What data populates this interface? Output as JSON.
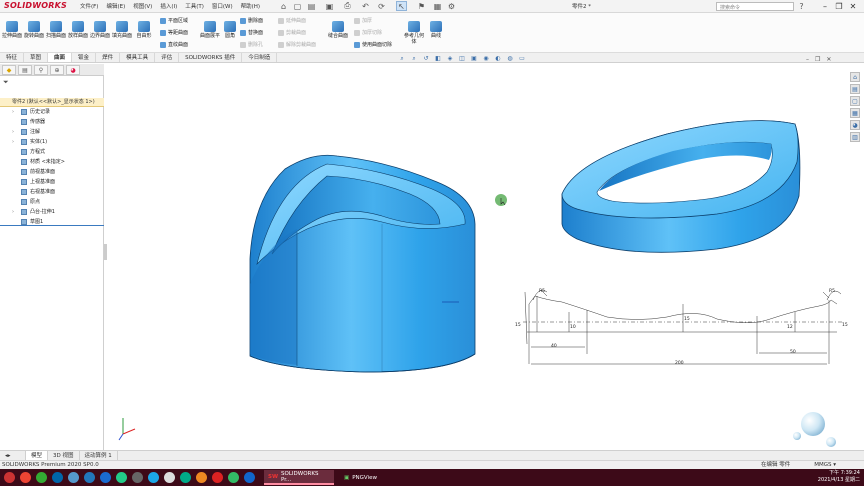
{
  "titlebar": {
    "logo": "SOLIDWORKS",
    "menus": [
      "文件(F)",
      "编辑(E)",
      "视图(V)",
      "插入(I)",
      "工具(T)",
      "窗口(W)",
      "帮助(H)"
    ],
    "document_title": "零件2 *",
    "search_placeholder": "搜索命令"
  },
  "ribbon": {
    "large_buttons": [
      "拉伸曲面",
      "旋转曲面",
      "扫描曲面",
      "放样曲面",
      "边界曲面",
      "填充曲面",
      "自由形"
    ],
    "small_col1": [
      "平面区域",
      "等距曲面",
      "直纹曲面"
    ],
    "mid_buttons": [
      "曲面展平",
      "圆角"
    ],
    "small_col2": [
      "删除面",
      "替换面",
      "删除孔"
    ],
    "small_col3": [
      "延伸曲面",
      "剪裁曲面",
      "解除剪裁曲面"
    ],
    "mid_buttons2": [
      "缝合曲面"
    ],
    "small_col4": [
      "加厚",
      "加厚切除",
      "使用曲面切除"
    ],
    "right_buttons": [
      "参考几何体",
      "曲线"
    ]
  },
  "tabs": [
    "特征",
    "草图",
    "曲面",
    "钣金",
    "焊件",
    "模具工具",
    "评估",
    "SOLIDWORKS 插件",
    "今日制造"
  ],
  "tree": {
    "root": "零件2 (默认<<默认>_显示状态 1>)",
    "items": [
      "历史记录",
      "传感器",
      "注解",
      "实体(1)",
      "方程式",
      "材质 <未指定>",
      "前视基准面",
      "上视基准面",
      "右视基准面",
      "原点",
      "凸台-拉伸1",
      "草图1"
    ]
  },
  "drawing": {
    "dim_40": "40",
    "dim_50": "50",
    "dim_200": "200",
    "dim_15a": "15",
    "dim_15b": "15",
    "dim_10": "10",
    "dim_12": "12",
    "dim_15c": "15",
    "ang_l": "R5",
    "ang_r": "R5"
  },
  "bottom_tabs": [
    "模型",
    "3D 视图",
    "运动算例 1"
  ],
  "status": {
    "left": "SOLIDWORKS Premium 2020 SP0.0",
    "mode": "在编辑 零件",
    "units": "MMGS",
    "arrow": "▾"
  },
  "taskbar": {
    "apps": [
      "SOLIDWORKS Pr...",
      "PNGView"
    ],
    "time": "下午 7:39:24",
    "date": "2021/4/13 星期二"
  },
  "colors": {
    "part_blue": "#2e9fe6",
    "accent_red": "#c8102e",
    "taskbar": "#3d0a18"
  }
}
